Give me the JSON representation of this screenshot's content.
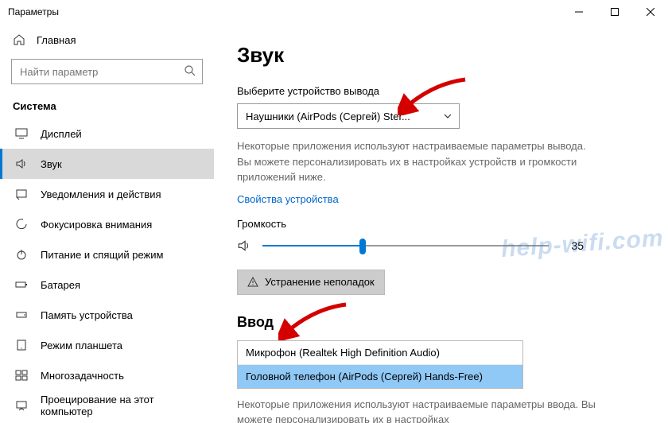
{
  "window": {
    "title": "Параметры"
  },
  "sidebar": {
    "home": "Главная",
    "search_placeholder": "Найти параметр",
    "section": "Система",
    "items": [
      {
        "label": "Дисплей"
      },
      {
        "label": "Звук"
      },
      {
        "label": "Уведомления и действия"
      },
      {
        "label": "Фокусировка внимания"
      },
      {
        "label": "Питание и спящий режим"
      },
      {
        "label": "Батарея"
      },
      {
        "label": "Память устройства"
      },
      {
        "label": "Режим планшета"
      },
      {
        "label": "Многозадачность"
      },
      {
        "label": "Проецирование на этот компьютер"
      }
    ],
    "active_index": 1
  },
  "main": {
    "heading": "Звук",
    "output": {
      "label": "Выберите устройство вывода",
      "selected": "Наушники (AirPods (Сергей) Ster...",
      "description": "Некоторые приложения используют настраиваемые параметры вывода. Вы можете персонализировать их в настройках устройств и громкости приложений ниже.",
      "properties_link": "Свойства устройства",
      "volume_label": "Громкость",
      "volume_value": 35,
      "troubleshoot": "Устранение неполадок"
    },
    "input": {
      "heading": "Ввод",
      "options": [
        "Микрофон (Realtek High Definition Audio)",
        "Головной телефон (AirPods (Сергей) Hands-Free)"
      ],
      "selected_index": 1,
      "description": "Некоторые приложения используют настраиваемые параметры ввода. Вы можете персонализировать их в настройках"
    }
  },
  "watermark": "help-wifi.com"
}
